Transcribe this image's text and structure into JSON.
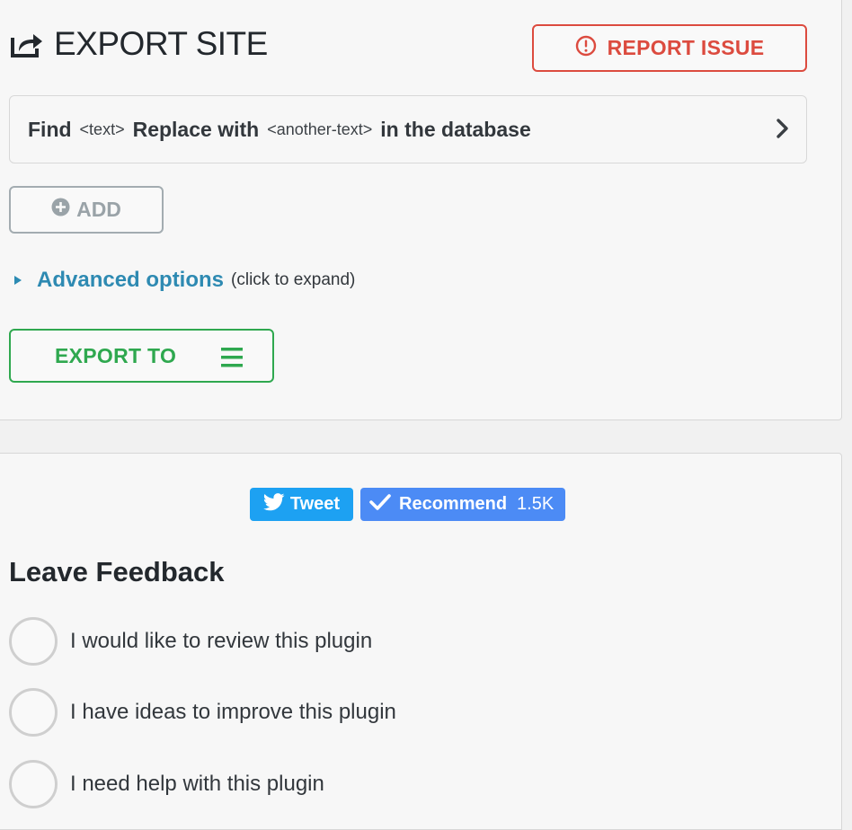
{
  "header": {
    "title": "EXPORT SITE",
    "title_icon": "share-export-icon",
    "report_label": "REPORT ISSUE",
    "report_icon": "exclamation-circle-icon"
  },
  "replace": {
    "find_label": "Find",
    "find_placeholder": "<text>",
    "replace_label": "Replace with",
    "replace_placeholder": "<another-text>",
    "suffix": "in the database",
    "chevron_icon": "chevron-right-icon"
  },
  "add": {
    "label": "ADD",
    "icon": "plus-circle-icon"
  },
  "advanced": {
    "label": "Advanced options",
    "hint": "(click to expand)"
  },
  "export": {
    "label": "EXPORT TO",
    "icon": "menu-icon"
  },
  "social": {
    "tweet_label": "Tweet",
    "recommend_label": "Recommend",
    "recommend_count": "1.5K"
  },
  "feedback": {
    "heading": "Leave Feedback",
    "options": [
      "I would like to review this plugin",
      "I have ideas to improve this plugin",
      "I need help with this plugin"
    ]
  },
  "colors": {
    "report": "#dc4b3f",
    "export": "#2fa84f",
    "link": "#2e8ab2",
    "tweet": "#1da1f2",
    "recommend": "#4c8bf5"
  }
}
